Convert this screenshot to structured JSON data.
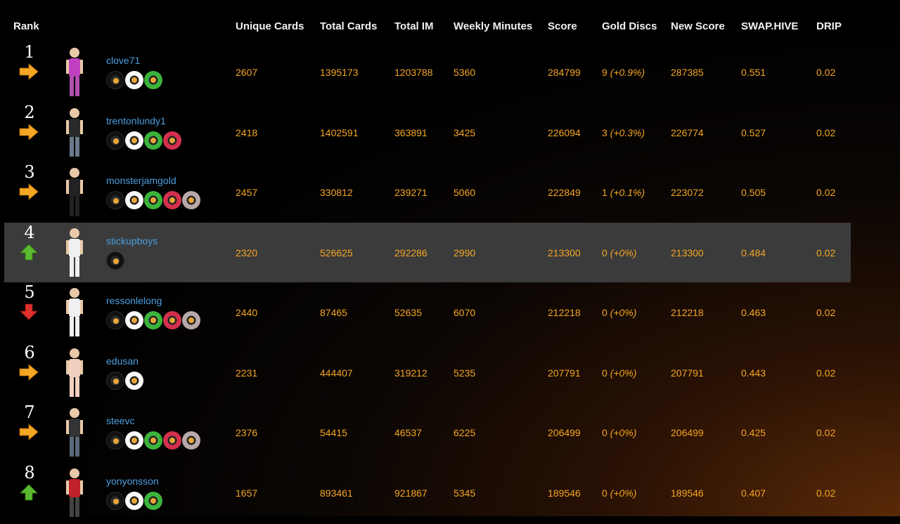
{
  "headers": {
    "rank": "Rank",
    "unique_cards": "Unique Cards",
    "total_cards": "Total Cards",
    "total_im": "Total IM",
    "weekly_minutes": "Weekly Minutes",
    "score": "Score",
    "gold_discs": "Gold Discs",
    "new_score": "New Score",
    "swaphive": "SWAP.HIVE",
    "drip": "DRIP"
  },
  "colors": {
    "accent": "#f5a623",
    "username": "#4a9fe0",
    "arrow_right": "#f5a623",
    "arrow_up": "#5cb82f",
    "arrow_down": "#e0302a",
    "highlight_row": "#3b3b3b"
  },
  "rows": [
    {
      "rank": "1",
      "trend": "right",
      "username": "clove71",
      "discs": [
        "black",
        "white",
        "green"
      ],
      "unique_cards": "2607",
      "total_cards": "1395173",
      "total_im": "1203788",
      "weekly_minutes": "5360",
      "score": "284799",
      "gold_count": "9",
      "gold_pct": "(+0.9%)",
      "new_score": "287385",
      "swaphive": "0.551",
      "drip": "0.02",
      "highlight": false
    },
    {
      "rank": "2",
      "trend": "right",
      "username": "trentonlundy1",
      "discs": [
        "black",
        "white",
        "green",
        "red"
      ],
      "unique_cards": "2418",
      "total_cards": "1402591",
      "total_im": "363891",
      "weekly_minutes": "3425",
      "score": "226094",
      "gold_count": "3",
      "gold_pct": "(+0.3%)",
      "new_score": "226774",
      "swaphive": "0.527",
      "drip": "0.02",
      "highlight": false
    },
    {
      "rank": "3",
      "trend": "right",
      "username": "monsterjamgold",
      "discs": [
        "black",
        "white",
        "green",
        "red",
        "gray"
      ],
      "unique_cards": "2457",
      "total_cards": "330812",
      "total_im": "239271",
      "weekly_minutes": "5060",
      "score": "222849",
      "gold_count": "1",
      "gold_pct": "(+0.1%)",
      "new_score": "223072",
      "swaphive": "0.505",
      "drip": "0.02",
      "highlight": false
    },
    {
      "rank": "4",
      "trend": "up",
      "username": "stickupboys",
      "discs": [
        "black"
      ],
      "unique_cards": "2320",
      "total_cards": "526625",
      "total_im": "292286",
      "weekly_minutes": "2990",
      "score": "213300",
      "gold_count": "0",
      "gold_pct": "(+0%)",
      "new_score": "213300",
      "swaphive": "0.484",
      "drip": "0.02",
      "highlight": true
    },
    {
      "rank": "5",
      "trend": "down",
      "username": "ressonlelong",
      "discs": [
        "black",
        "white",
        "green",
        "red",
        "gray"
      ],
      "unique_cards": "2440",
      "total_cards": "87465",
      "total_im": "52635",
      "weekly_minutes": "6070",
      "score": "212218",
      "gold_count": "0",
      "gold_pct": "(+0%)",
      "new_score": "212218",
      "swaphive": "0.463",
      "drip": "0.02",
      "highlight": false
    },
    {
      "rank": "6",
      "trend": "right",
      "username": "edusan",
      "discs": [
        "black",
        "white"
      ],
      "unique_cards": "2231",
      "total_cards": "444407",
      "total_im": "319212",
      "weekly_minutes": "5235",
      "score": "207791",
      "gold_count": "0",
      "gold_pct": "(+0%)",
      "new_score": "207791",
      "swaphive": "0.443",
      "drip": "0.02",
      "highlight": false
    },
    {
      "rank": "7",
      "trend": "right",
      "username": "steevc",
      "discs": [
        "black",
        "white",
        "green",
        "red",
        "gray"
      ],
      "unique_cards": "2376",
      "total_cards": "54415",
      "total_im": "46537",
      "weekly_minutes": "6225",
      "score": "206499",
      "gold_count": "0",
      "gold_pct": "(+0%)",
      "new_score": "206499",
      "swaphive": "0.425",
      "drip": "0.02",
      "highlight": false
    },
    {
      "rank": "8",
      "trend": "up",
      "username": "yonyonsson",
      "discs": [
        "black",
        "white",
        "green"
      ],
      "unique_cards": "1657",
      "total_cards": "893461",
      "total_im": "921867",
      "weekly_minutes": "5345",
      "score": "189546",
      "gold_count": "0",
      "gold_pct": "(+0%)",
      "new_score": "189546",
      "swaphive": "0.407",
      "drip": "0.02",
      "highlight": false
    }
  ]
}
